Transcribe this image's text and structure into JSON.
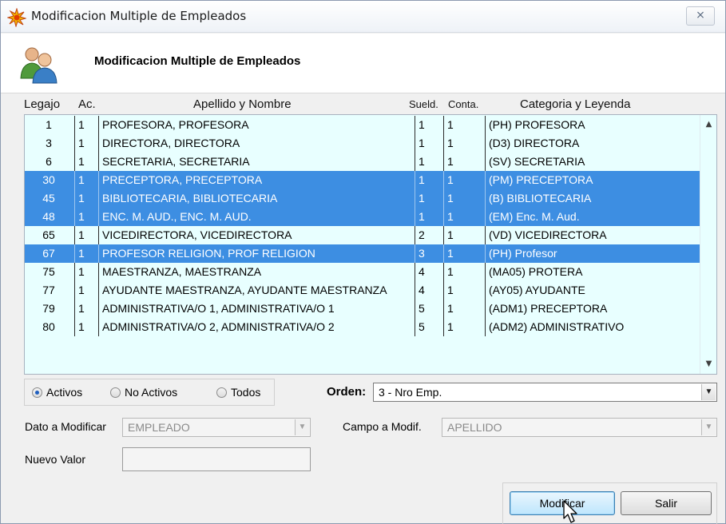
{
  "window": {
    "title": "Modificacion Multiple de Empleados",
    "close_symbol": "⨯"
  },
  "header": {
    "title": "Modificacion Multiple de Empleados"
  },
  "columns": {
    "legajo": "Legajo",
    "ac": "Ac.",
    "nombre": "Apellido y Nombre",
    "sueld": "Sueld.",
    "conta": "Conta.",
    "categoria": "Categoria y Leyenda"
  },
  "rows": [
    {
      "legajo": "1",
      "ac": "1",
      "nombre": "PROFESORA, PROFESORA",
      "sueld": "1",
      "conta": "1",
      "categoria": "(PH) PROFESORA",
      "selected": false
    },
    {
      "legajo": "3",
      "ac": "1",
      "nombre": "DIRECTORA, DIRECTORA",
      "sueld": "1",
      "conta": "1",
      "categoria": "(D3) DIRECTORA",
      "selected": false
    },
    {
      "legajo": "6",
      "ac": "1",
      "nombre": "SECRETARIA, SECRETARIA",
      "sueld": "1",
      "conta": "1",
      "categoria": "(SV) SECRETARIA",
      "selected": false
    },
    {
      "legajo": "30",
      "ac": "1",
      "nombre": "PRECEPTORA, PRECEPTORA",
      "sueld": "1",
      "conta": "1",
      "categoria": "(PM) PRECEPTORA",
      "selected": true
    },
    {
      "legajo": "45",
      "ac": "1",
      "nombre": "BIBLIOTECARIA, BIBLIOTECARIA",
      "sueld": "1",
      "conta": "1",
      "categoria": "(B) BIBLIOTECARIA",
      "selected": true
    },
    {
      "legajo": "48",
      "ac": "1",
      "nombre": "ENC. M. AUD., ENC. M. AUD.",
      "sueld": "1",
      "conta": "1",
      "categoria": "(EM) Enc. M. Aud.",
      "selected": true
    },
    {
      "legajo": "65",
      "ac": "1",
      "nombre": "VICEDIRECTORA, VICEDIRECTORA",
      "sueld": "2",
      "conta": "1",
      "categoria": "(VD) VICEDIRECTORA",
      "selected": false
    },
    {
      "legajo": "67",
      "ac": "1",
      "nombre": "PROFESOR RELIGION, PROF RELIGION",
      "sueld": "3",
      "conta": "1",
      "categoria": "(PH) Profesor",
      "selected": true
    },
    {
      "legajo": "75",
      "ac": "1",
      "nombre": "MAESTRANZA, MAESTRANZA",
      "sueld": "4",
      "conta": "1",
      "categoria": "(MA05) PROTERA",
      "selected": false
    },
    {
      "legajo": "77",
      "ac": "1",
      "nombre": "AYUDANTE MAESTRANZA, AYUDANTE MAESTRANZA",
      "sueld": "4",
      "conta": "1",
      "categoria": "(AY05) AYUDANTE",
      "selected": false
    },
    {
      "legajo": "79",
      "ac": "1",
      "nombre": "ADMINISTRATIVA/O 1, ADMINISTRATIVA/O 1",
      "sueld": "5",
      "conta": "1",
      "categoria": "(ADM1) PRECEPTORA",
      "selected": false
    },
    {
      "legajo": "80",
      "ac": "1",
      "nombre": "ADMINISTRATIVA/O 2, ADMINISTRATIVA/O 2",
      "sueld": "5",
      "conta": "1",
      "categoria": "(ADM2) ADMINISTRATIVO",
      "selected": false
    }
  ],
  "filter": {
    "options": [
      "Activos",
      "No Activos",
      "Todos"
    ],
    "selected": "Activos"
  },
  "orden": {
    "label": "Orden:",
    "value": "3  - Nro Emp."
  },
  "dato": {
    "label": "Dato a Modificar",
    "value": "EMPLEADO"
  },
  "campo": {
    "label": "Campo a Modif.",
    "value": "APELLIDO"
  },
  "nuevo": {
    "label": "Nuevo Valor",
    "value": ""
  },
  "buttons": {
    "modificar": "Modificar",
    "salir": "Salir"
  },
  "icons": {
    "app": "sunburst-icon",
    "header": "users-icon",
    "scroll_up": "▲",
    "scroll_down": "▼",
    "dropdown": "▼"
  }
}
